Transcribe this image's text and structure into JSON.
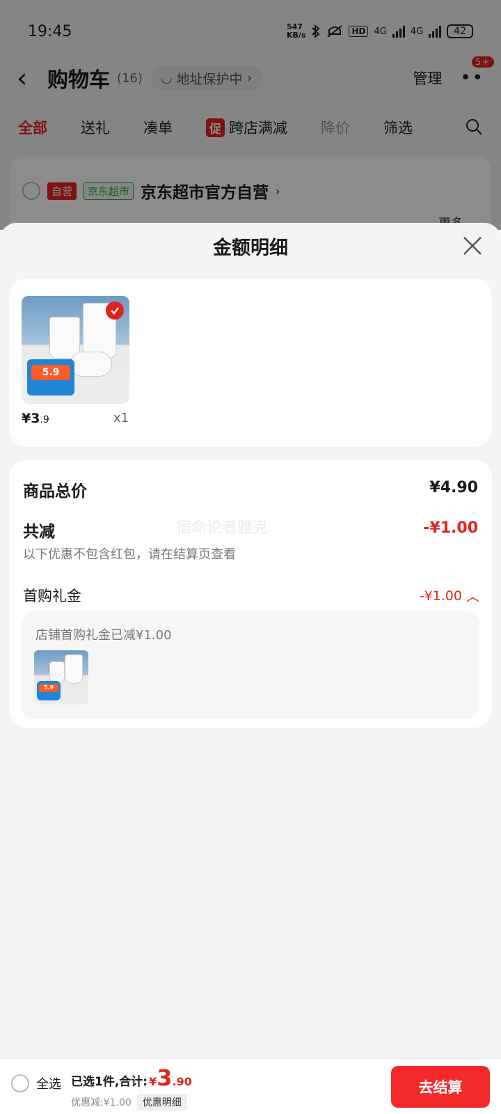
{
  "status_bar": {
    "time": "19:45",
    "net_speed_value": "547",
    "net_speed_unit": "KB/s",
    "hd_label": "HD",
    "net_type_1": "4G",
    "net_type_2": "4G",
    "battery": "42"
  },
  "header": {
    "title": "购物车",
    "count": "(16)",
    "address_label": "地址保护中",
    "manage_label": "管理",
    "more_badge": "5+"
  },
  "tabs": [
    {
      "label": "全部"
    },
    {
      "label": "送礼"
    },
    {
      "label": "凑单"
    },
    {
      "label": "跨店满减",
      "tag": "促"
    },
    {
      "label": "降价"
    },
    {
      "label": "筛选"
    }
  ],
  "store": {
    "tag_self": "自营",
    "tag_jd": "京东超市",
    "name": "京东超市官方自营",
    "more": "更多"
  },
  "sheet": {
    "title": "金额明细",
    "item": {
      "badge_price": "5.9",
      "price_main": "¥3",
      "price_dec": ".9",
      "qty": "x1"
    },
    "total_label": "商品总价",
    "total_value": "¥4.90",
    "discount_label": "共减",
    "discount_value": "-¥1.00",
    "discount_note": "以下优惠不包含红包，请在结算页查看",
    "watermark": "宿命论者雅克",
    "gift_label": "首购礼金",
    "gift_value": "-¥1.00",
    "gift_box_text": "店铺首购礼金已减¥1.00",
    "gift_badge_price": "5.9"
  },
  "bottom_bar": {
    "select_all": "全选",
    "summary_prefix": "已选1件,合计:",
    "currency": "¥",
    "total_int": "3",
    "total_dec": ".90",
    "discount_text": "优惠减:¥1.00",
    "detail_label": "优惠明细",
    "checkout_label": "去结算"
  },
  "colors": {
    "accent": "#e2231a",
    "checkout": "#f42a2a",
    "green_tag": "#3aa655"
  }
}
